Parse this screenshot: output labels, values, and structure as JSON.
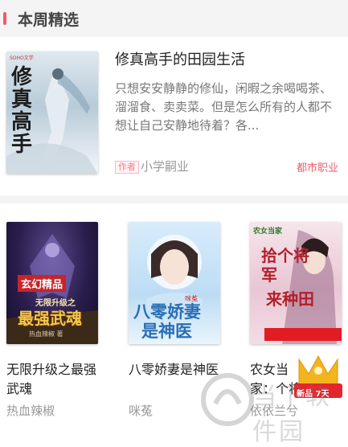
{
  "section": {
    "title": "本周精选"
  },
  "featured": {
    "title": "修真高手的田园生活",
    "description": "只想安安静静的修仙，闲暇之余喝喝茶、溜溜食、卖卖菜。但是怎么所有的人都不想让自己安静地待着？各...",
    "author_tag": "作者",
    "author": "小学嗣业",
    "genre": "都市职业",
    "cover_text": "修真高手",
    "cover_publisher": "SOHO文学"
  },
  "books": [
    {
      "title": "无限升级之最强武魂",
      "author": "热血辣椒",
      "cover_badge": "玄幻精品",
      "cover_text": "无限升级之",
      "cover_text2": "最强武魂",
      "cover_author": "热血辣椒 著"
    },
    {
      "title": "八零娇妻是神医",
      "author": "咪菟",
      "cover_text": "八零娇妻",
      "cover_text2": "是神医",
      "cover_author": "咪菟"
    },
    {
      "title": "农女当家：拐个将军来种田",
      "title_visible": "农女当家：个将军",
      "author": "依依兰兮",
      "cover_text": "拾个将军",
      "cover_text2": "来种田",
      "cover_top": "农女当家"
    }
  ],
  "hot_badge": {
    "text": "新品 7天"
  },
  "watermark": {
    "text": "当下软件园"
  }
}
